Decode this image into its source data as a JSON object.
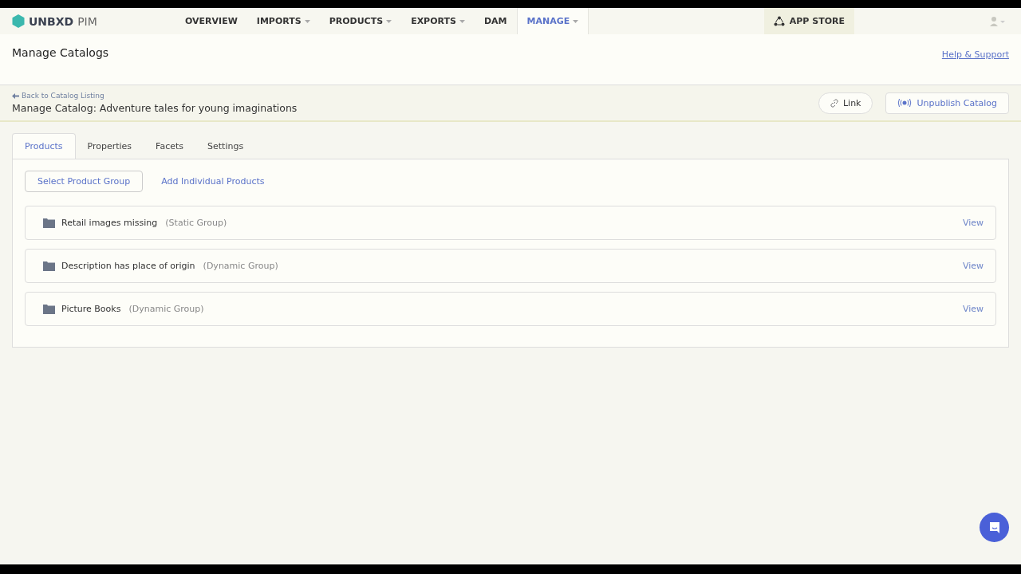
{
  "brand": {
    "name": "UNBXD",
    "suffix": "PIM"
  },
  "nav": [
    {
      "label": "OVERVIEW",
      "dropdown": false,
      "selected": false
    },
    {
      "label": "IMPORTS",
      "dropdown": true,
      "selected": false
    },
    {
      "label": "PRODUCTS",
      "dropdown": true,
      "selected": false
    },
    {
      "label": "EXPORTS",
      "dropdown": true,
      "selected": false
    },
    {
      "label": "DAM",
      "dropdown": false,
      "selected": false
    },
    {
      "label": "MANAGE",
      "dropdown": true,
      "selected": true
    }
  ],
  "app_store": "APP STORE",
  "page_title": "Manage Catalogs",
  "help_link": "Help & Support",
  "back_link": "Back to Catalog Listing",
  "catalog_title": "Manage Catalog: Adventure tales for young imaginations",
  "actions": [
    {
      "label": "Link",
      "kind": "link"
    },
    {
      "label": "Unpublish Catalog",
      "kind": "unpublish"
    }
  ],
  "tabs": [
    {
      "label": "Products",
      "selected": true
    },
    {
      "label": "Properties",
      "selected": false
    },
    {
      "label": "Facets",
      "selected": false
    },
    {
      "label": "Settings",
      "selected": false
    }
  ],
  "subtabs": [
    {
      "label": "Select Product Group",
      "selected": true
    },
    {
      "label": "Add Individual Products",
      "selected": false
    }
  ],
  "groups": [
    {
      "name": "Retail images missing",
      "type": "(Static Group)",
      "action": "View"
    },
    {
      "name": "Description has place of origin",
      "type": "(Dynamic Group)",
      "action": "View"
    },
    {
      "name": "Picture Books",
      "type": "(Dynamic Group)",
      "action": "View"
    }
  ]
}
